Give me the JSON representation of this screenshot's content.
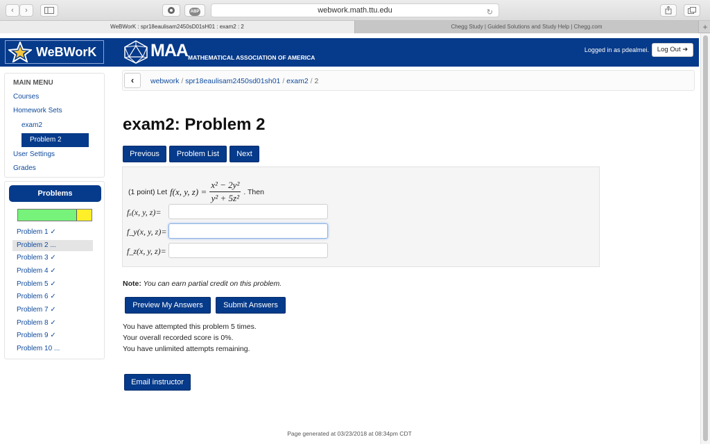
{
  "browser": {
    "url": "webwork.math.ttu.edu",
    "tabs": [
      {
        "label": "WeBWorK : spr18eaulisam2450sD01sH01 : exam2 : 2",
        "active": true
      },
      {
        "label": "Chegg Study | Guided Solutions and Study Help | Chegg.com",
        "active": false
      }
    ],
    "new_tab_label": "+",
    "extension_badge": "ABP"
  },
  "header": {
    "logo": "WeBWorK",
    "maa_logo": "MAA",
    "maa_subtitle": "MATHEMATICAL ASSOCIATION OF AMERICA",
    "logged_in": "Logged in as pdealmei.",
    "logout": "Log Out"
  },
  "main_menu": {
    "heading": "MAIN MENU",
    "courses": "Courses",
    "homework_sets": "Homework Sets",
    "exam2": "exam2",
    "problem2": "Problem 2",
    "user_settings": "User Settings",
    "grades": "Grades"
  },
  "problems_panel": {
    "title": "Problems",
    "progress": {
      "correct_fraction": 0.8,
      "in_progress_fraction": 0.2,
      "correct_color": "#77f27a",
      "in_progress_color": "#ffef29"
    },
    "items": [
      {
        "label": "Problem 1 ✓"
      },
      {
        "label": "Problem 2 ..."
      },
      {
        "label": "Problem 3 ✓"
      },
      {
        "label": "Problem 4 ✓"
      },
      {
        "label": "Problem 5 ✓"
      },
      {
        "label": "Problem 6 ✓"
      },
      {
        "label": "Problem 7 ✓"
      },
      {
        "label": "Problem 8 ✓"
      },
      {
        "label": "Problem 9 ✓"
      },
      {
        "label": "Problem 10 ..."
      }
    ]
  },
  "breadcrumb": {
    "items": [
      "webwork",
      "spr18eaulisam2450sd01sh01",
      "exam2"
    ],
    "separator": "/",
    "current": "2"
  },
  "page_title": "exam2: Problem 2",
  "nav_buttons": {
    "previous": "Previous",
    "problem_list": "Problem List",
    "next": "Next"
  },
  "problem": {
    "intro": "(1 point) Let",
    "function": "f(x, y, z) =",
    "numerator": "x² − 2y²",
    "denominator": "y² + 5z²",
    "then": ". Then",
    "answers": [
      {
        "label": "fₓ(x, y, z)=",
        "value": ""
      },
      {
        "label": "f_y(x, y, z)=",
        "value": ""
      },
      {
        "label": "f_z(x, y, z)=",
        "value": ""
      }
    ]
  },
  "note": {
    "bold": "Note:",
    "text": " You can earn partial credit on this problem."
  },
  "actions": {
    "preview": "Preview My Answers",
    "submit": "Submit Answers"
  },
  "status": {
    "attempted": "You have attempted this problem 5 times.",
    "score": "Your overall recorded score is 0%.",
    "remaining": "You have unlimited attempts remaining."
  },
  "email_button": "Email instructor",
  "footer": "Page generated at 03/23/2018 at 08:34pm CDT",
  "colors": {
    "primary": "#063a8a",
    "link": "#0e4a9c"
  }
}
